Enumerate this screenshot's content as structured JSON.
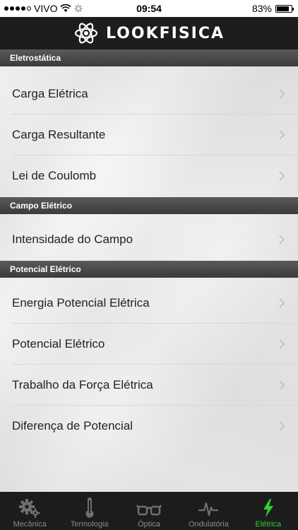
{
  "status_bar": {
    "carrier": "VIVO",
    "time": "09:54",
    "battery": "83%",
    "battery_level": 0.83
  },
  "header": {
    "title": "LOOKFISICA"
  },
  "sections": [
    {
      "title": "Eletrostática",
      "items": [
        "Carga Elétrica",
        "Carga Resultante",
        "Lei de Coulomb"
      ]
    },
    {
      "title": "Campo Elétrico",
      "items": [
        "Intensidade do Campo"
      ]
    },
    {
      "title": "Potencial Elétrico",
      "items": [
        "Energia Potencial Elétrica",
        "Potencial Elétrico",
        "Trabalho da Força Elétrica",
        "Diferença de Potencial"
      ]
    }
  ],
  "tabs": [
    {
      "label": "Mecânica",
      "icon": "gears-icon"
    },
    {
      "label": "Termologia",
      "icon": "thermometer-icon"
    },
    {
      "label": "Óptica",
      "icon": "glasses-icon"
    },
    {
      "label": "Ondulatória",
      "icon": "wave-icon"
    },
    {
      "label": "Elétrica",
      "icon": "lightning-icon",
      "active": true
    }
  ],
  "colors": {
    "active_tab": "#2ed02e",
    "nav_bg": "#1d1d1d",
    "section_bg": "#4a4a4a"
  }
}
